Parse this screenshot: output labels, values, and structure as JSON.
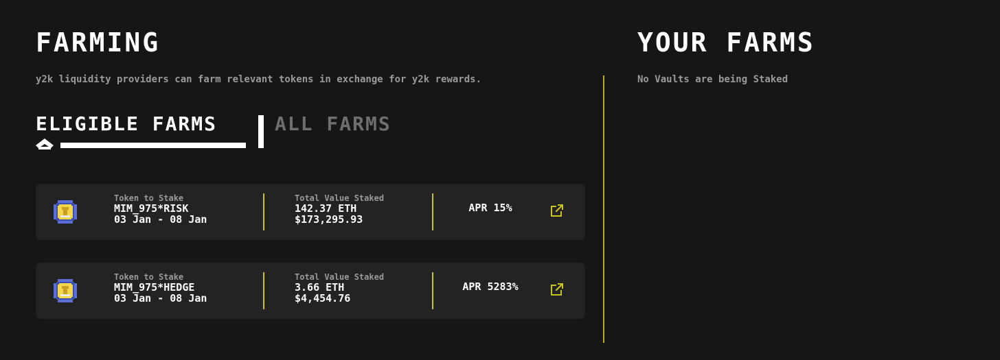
{
  "farming": {
    "title": "FARMING",
    "description": "y2k liquidity providers can farm relevant tokens in exchange for y2k rewards.",
    "tabs": [
      {
        "label": "ELIGIBLE FARMS",
        "active": true
      },
      {
        "label": "ALL FARMS",
        "active": false
      }
    ],
    "cards": [
      {
        "token_label": "Token to Stake",
        "token_name": "MIM_975*RISK",
        "date_range": "03 Jan - 08 Jan",
        "tvs_label": "Total Value Staked",
        "tvs_eth": "142.37 ETH",
        "tvs_usd": "$173,295.93",
        "apr": "APR 15%",
        "icon": "mim-token-icon",
        "action_icon": "external-link-icon"
      },
      {
        "token_label": "Token to Stake",
        "token_name": "MIM_975*HEDGE",
        "date_range": "03 Jan - 08 Jan",
        "tvs_label": "Total Value Staked",
        "tvs_eth": "3.66 ETH",
        "tvs_usd": "$4,454.76",
        "apr": "APR 5283%",
        "icon": "mim-token-icon",
        "action_icon": "external-link-icon"
      }
    ]
  },
  "your_farms": {
    "title": "YOUR FARMS",
    "empty_message": "No Vaults are being Staked"
  },
  "colors": {
    "background": "#161616",
    "card": "#232323",
    "accent": "#c9c41e",
    "muted_text": "#9a9a9a",
    "inactive_tab": "#6e6e6e"
  }
}
